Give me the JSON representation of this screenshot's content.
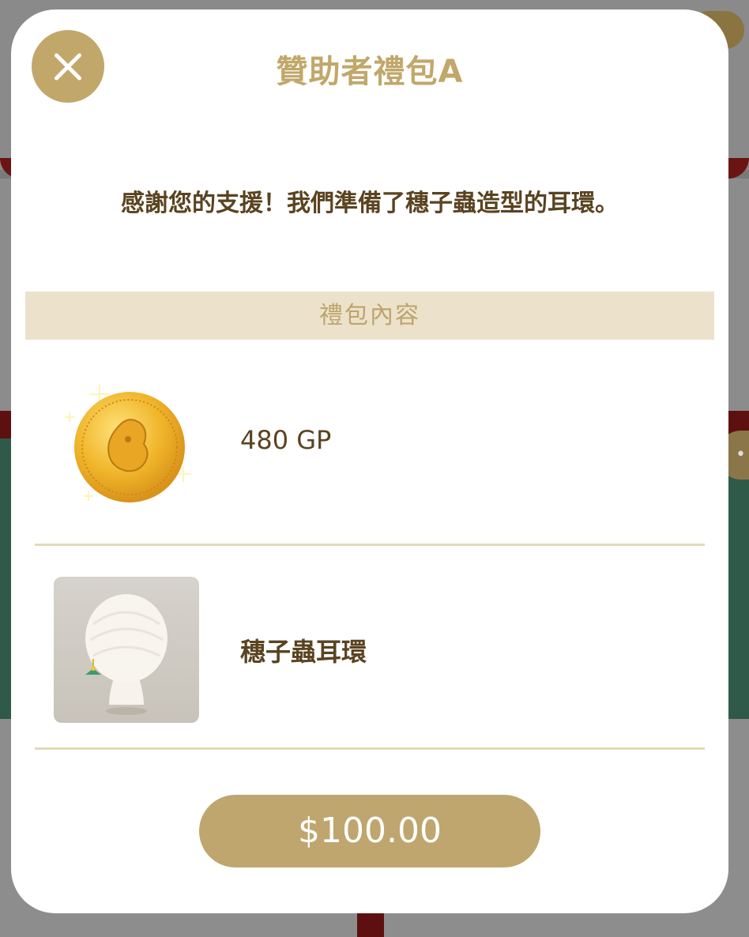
{
  "modal": {
    "title": "贊助者禮包A",
    "description": "感謝您的支援！我們準備了穗子蟲造型的耳環。",
    "section_header": "禮包內容",
    "items": [
      {
        "label": "480 GP",
        "icon": "gold-coin-icon"
      },
      {
        "label": "穗子蟲耳環",
        "icon": "earring-avatar-thumbnail"
      }
    ],
    "price_label": "$100.00",
    "close_icon": "close-icon"
  },
  "colors": {
    "accent": "#c1a86a",
    "section_bg": "#ece2cc",
    "text_dark": "#5a4320",
    "divider": "#e5d9b9"
  }
}
